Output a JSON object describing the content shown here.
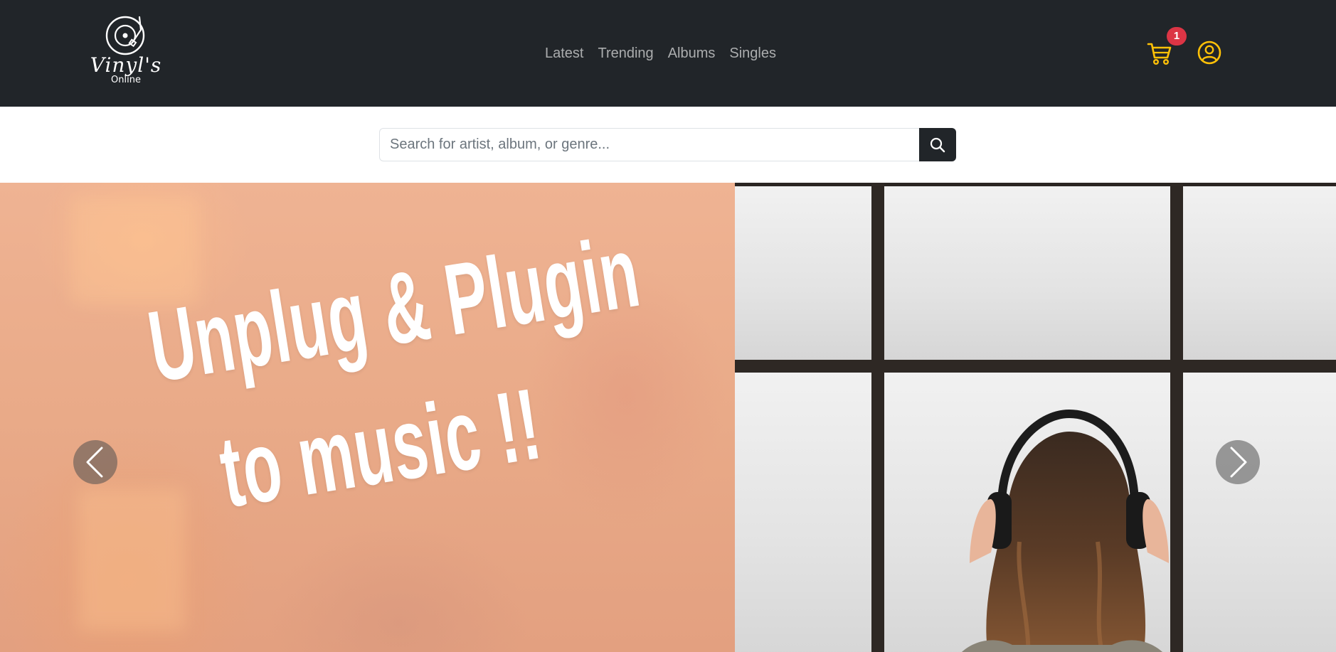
{
  "brand": {
    "name": "Vinyl's",
    "tagline": "Online",
    "icon": "turntable-record-icon"
  },
  "nav": {
    "links": [
      {
        "label": "Latest"
      },
      {
        "label": "Trending"
      },
      {
        "label": "Albums"
      },
      {
        "label": "Singles"
      }
    ]
  },
  "cart": {
    "icon": "cart-icon",
    "count": "1",
    "accent": "#ffc107",
    "badge_color": "#dc3545"
  },
  "account": {
    "icon": "user-circle-icon"
  },
  "search": {
    "placeholder": "Search for artist, album, or genre...",
    "value": "",
    "button_icon": "search-icon"
  },
  "carousel": {
    "slogan_line_1": "Unplug & Plugin",
    "slogan_line_2": "to music !!",
    "prev_icon": "chevron-left-icon",
    "next_icon": "chevron-right-icon",
    "photo": "woman-with-headphones-at-window"
  },
  "colors": {
    "navbar_bg": "#212529",
    "nav_link": "rgba(255,255,255,0.55)",
    "slide_bg": "#eaab8a"
  }
}
